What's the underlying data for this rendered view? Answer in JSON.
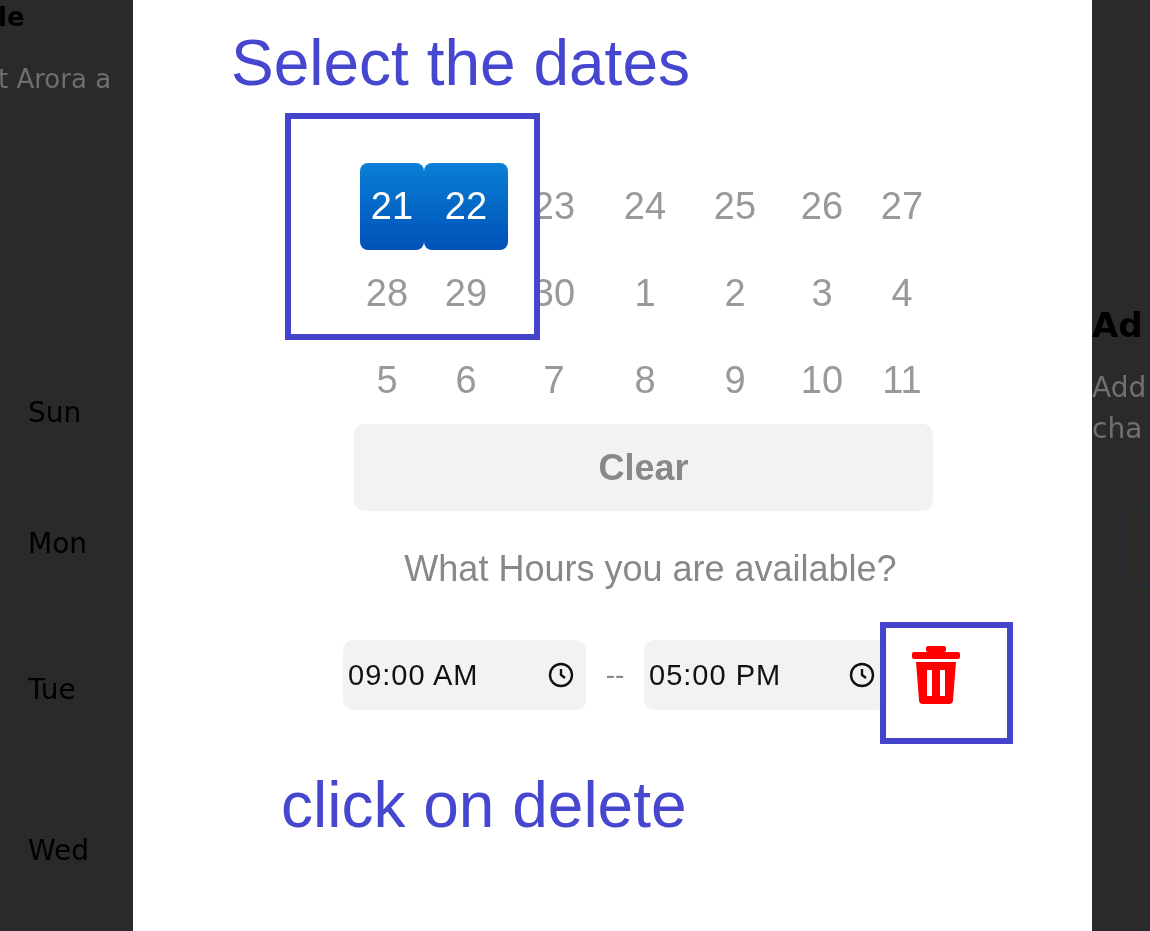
{
  "background": {
    "left": {
      "heading": "le",
      "subtitle": "t Arora a",
      "days": [
        "Sun",
        "Mon",
        "Tue",
        "Wed"
      ]
    },
    "right": {
      "heading": "Ad",
      "lines": [
        "Add",
        "cha"
      ]
    }
  },
  "modal": {
    "date_rows": [
      [
        {
          "day": "21",
          "selected": true
        },
        {
          "day": "22",
          "selected": true
        },
        {
          "day": "23",
          "selected": false
        },
        {
          "day": "24",
          "selected": false
        },
        {
          "day": "25",
          "selected": false
        },
        {
          "day": "26",
          "selected": false
        },
        {
          "day": "27",
          "selected": false
        }
      ],
      [
        {
          "day": "28",
          "selected": false
        },
        {
          "day": "29",
          "selected": false
        },
        {
          "day": "30",
          "selected": false
        },
        {
          "day": "1",
          "selected": false
        },
        {
          "day": "2",
          "selected": false
        },
        {
          "day": "3",
          "selected": false
        },
        {
          "day": "4",
          "selected": false
        }
      ],
      [
        {
          "day": "5",
          "selected": false
        },
        {
          "day": "6",
          "selected": false
        },
        {
          "day": "7",
          "selected": false
        },
        {
          "day": "8",
          "selected": false
        },
        {
          "day": "9",
          "selected": false
        },
        {
          "day": "10",
          "selected": false
        },
        {
          "day": "11",
          "selected": false
        }
      ]
    ],
    "clear_button": "Clear",
    "hours_prompt": "What Hours you are available?",
    "start_time": "09:00 AM",
    "separator": "--",
    "end_time": "05:00 PM"
  },
  "annotations": [
    {
      "kind": "text",
      "text": "Select the dates"
    },
    {
      "kind": "box"
    },
    {
      "kind": "box"
    },
    {
      "kind": "text",
      "text": "click on delete"
    }
  ]
}
